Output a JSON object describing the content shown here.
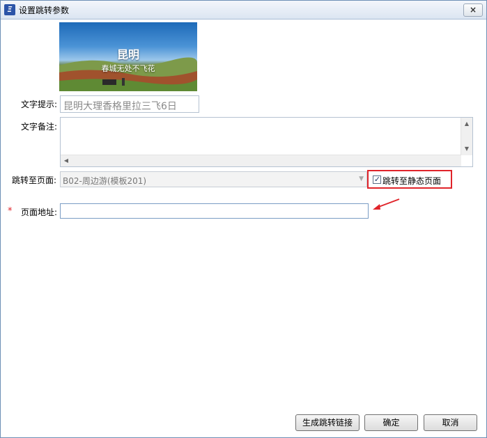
{
  "window": {
    "title": "设置跳转参数",
    "close_label": "×"
  },
  "banner": {
    "title": "昆明",
    "subtitle": "春城无处不飞花"
  },
  "form": {
    "text_hint_label": "文字提示:",
    "text_hint_value": "昆明大理香格里拉三飞6日",
    "text_note_label": "文字备注:",
    "text_note_value": "",
    "jump_page_label": "跳转至页面:",
    "jump_page_value": "B02-周边游(模板201)",
    "static_checkbox_label": "跳转至静态页面",
    "static_checkbox_checked": true,
    "required_mark": "*",
    "page_url_label": "页面地址:",
    "page_url_value": ""
  },
  "buttons": {
    "generate": "生成跳转链接",
    "ok": "确定",
    "cancel": "取消"
  },
  "colors": {
    "highlight": "#e0242a",
    "arrow": "#e0242a"
  }
}
